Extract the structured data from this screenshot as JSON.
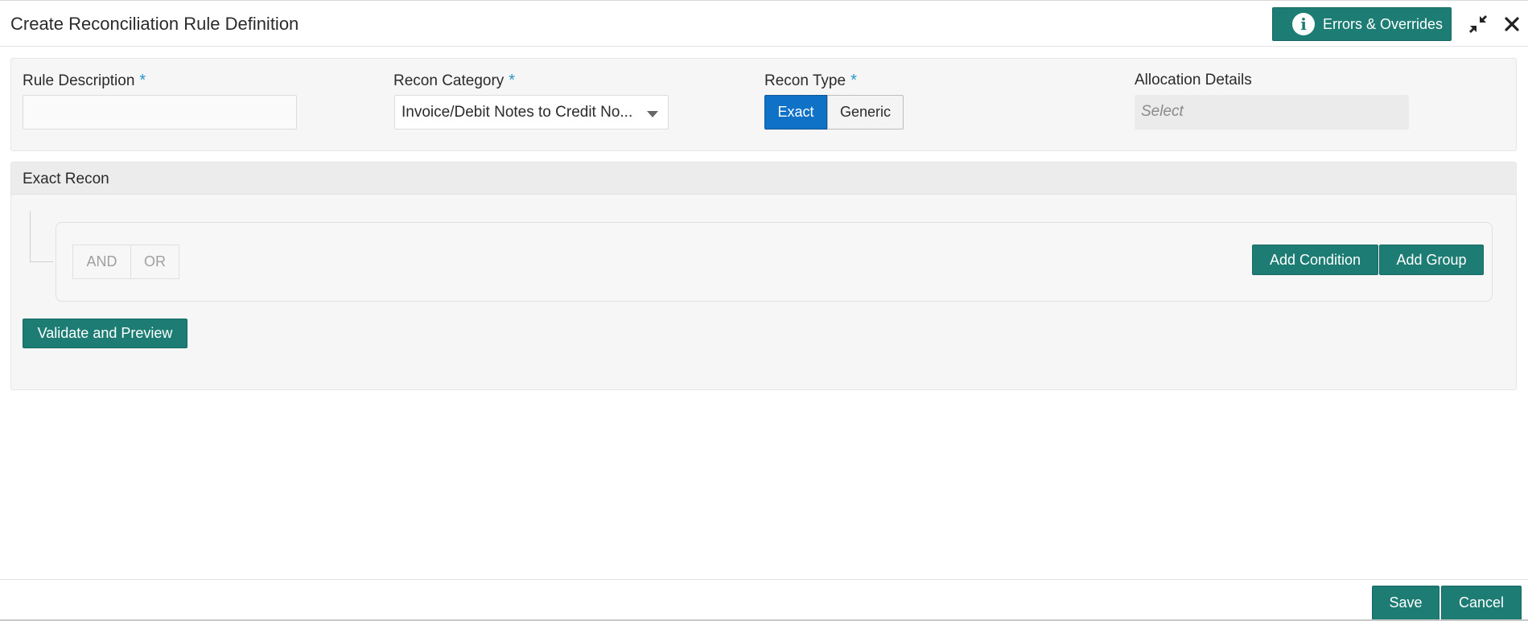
{
  "header": {
    "title": "Create Reconciliation Rule Definition",
    "errors_button_label": "Errors & Overrides",
    "info_glyph": "i"
  },
  "form": {
    "rule_description": {
      "label": "Rule Description",
      "required_mark": "*",
      "value": ""
    },
    "recon_category": {
      "label": "Recon Category",
      "required_mark": "*",
      "value": "Invoice/Debit Notes to Credit No..."
    },
    "recon_type": {
      "label": "Recon Type",
      "required_mark": "*",
      "options": [
        "Exact",
        "Generic"
      ],
      "selected": "Exact"
    },
    "allocation_details": {
      "label": "Allocation Details",
      "placeholder": "Select"
    }
  },
  "exact_recon": {
    "title": "Exact Recon",
    "logic_and": "AND",
    "logic_or": "OR",
    "add_condition_label": "Add Condition",
    "add_group_label": "Add Group",
    "validate_label": "Validate and Preview"
  },
  "footer": {
    "save_label": "Save",
    "cancel_label": "Cancel"
  },
  "colors": {
    "primary_teal": "#1d7d74",
    "selected_blue": "#0f72c6",
    "required_star": "#2a96c8"
  },
  "icons": {
    "info": "info-icon",
    "minimize": "minimize-icon",
    "close": "close-icon",
    "dropdown": "chevron-down-icon"
  }
}
